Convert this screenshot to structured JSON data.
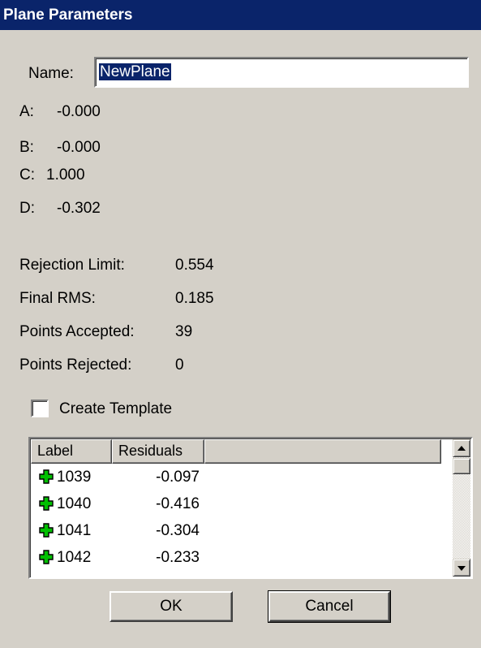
{
  "window": {
    "title": "Plane Parameters"
  },
  "name": {
    "label": "Name:",
    "value": "NewPlane"
  },
  "coefficients": [
    {
      "label": "A:",
      "value": "-0.000"
    },
    {
      "label": "B:",
      "value": "-0.000"
    },
    {
      "label": "C:",
      "value": "1.000"
    },
    {
      "label": "D:",
      "value": "-0.302"
    }
  ],
  "stats": [
    {
      "label": "Rejection Limit:",
      "value": "0.554"
    },
    {
      "label": "Final RMS:",
      "value": "0.185"
    },
    {
      "label": "Points Accepted:",
      "value": "39"
    },
    {
      "label": "Points Rejected:",
      "value": "0"
    }
  ],
  "create_template": {
    "label": "Create Template",
    "checked": false
  },
  "list": {
    "columns": [
      "Label",
      "Residuals"
    ],
    "rows": [
      {
        "icon": "plus-icon",
        "label": "1039",
        "residual": "-0.097"
      },
      {
        "icon": "plus-icon",
        "label": "1040",
        "residual": "-0.416"
      },
      {
        "icon": "plus-icon",
        "label": "1041",
        "residual": "-0.304"
      },
      {
        "icon": "plus-icon",
        "label": "1042",
        "residual": "-0.233"
      }
    ]
  },
  "buttons": {
    "ok": "OK",
    "cancel": "Cancel"
  },
  "colors": {
    "titlebar": "#0a246a",
    "face": "#d4d0c8",
    "plus_icon": "#00c000"
  }
}
